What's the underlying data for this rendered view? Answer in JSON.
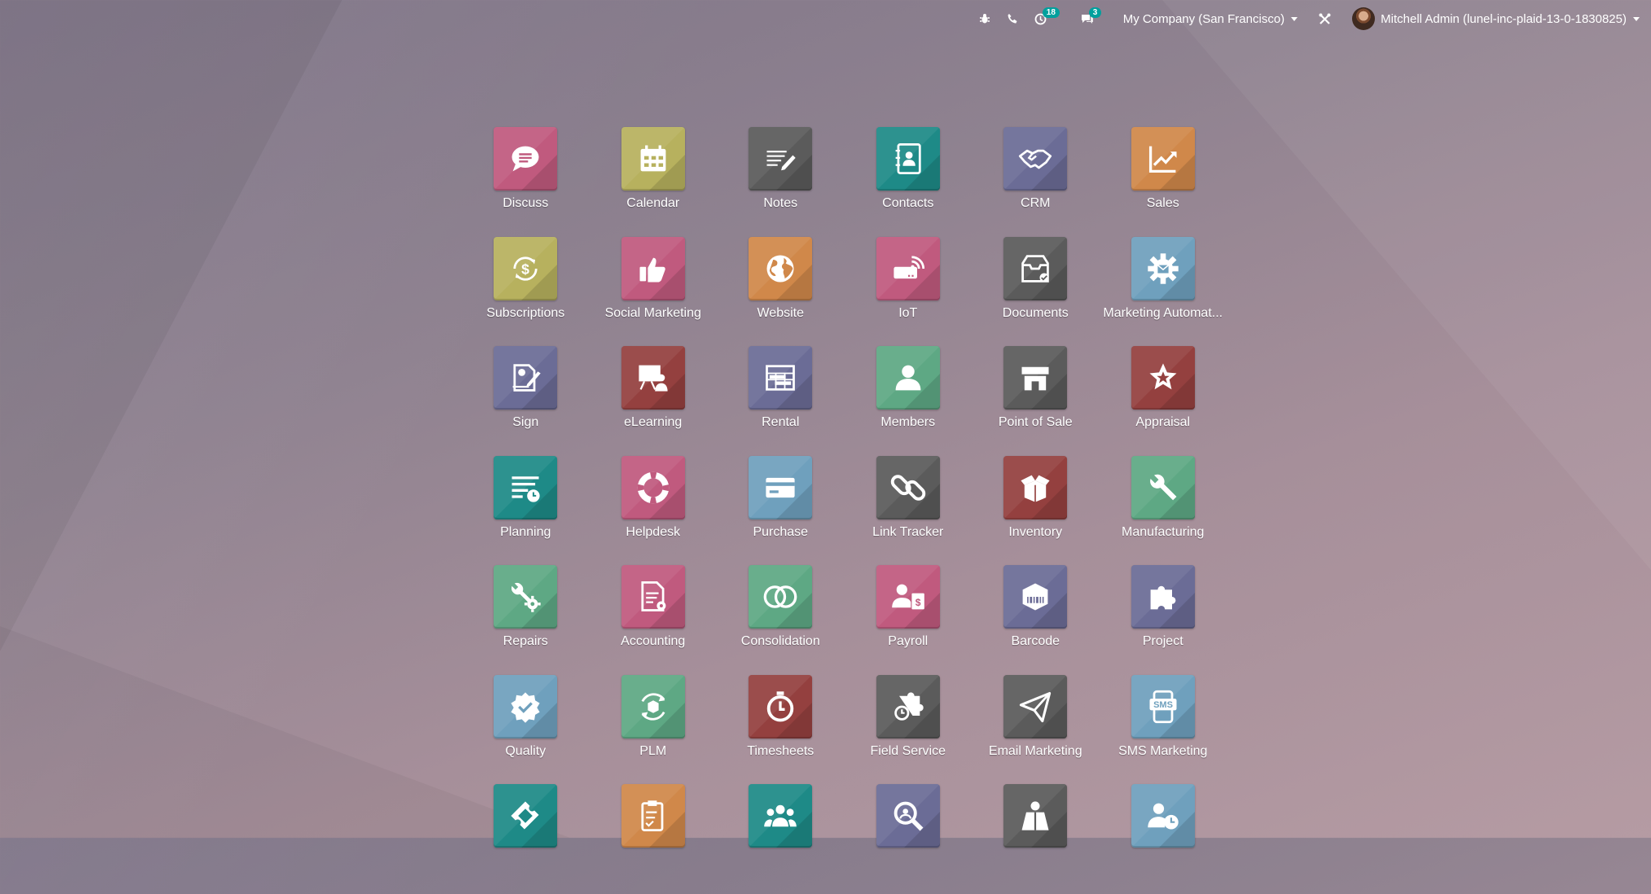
{
  "topbar": {
    "activities_count": "18",
    "messages_count": "3",
    "company": "My Company (San Francisco)",
    "user": "Mitchell Admin (lunel-inc-plaid-13-0-1830825)"
  },
  "apps": [
    {
      "name": "Discuss",
      "color": "#c05a7e",
      "icon": "chat-bubble-icon"
    },
    {
      "name": "Calendar",
      "color": "#b7b15e",
      "icon": "calendar-icon"
    },
    {
      "name": "Notes",
      "color": "#5b5b5b",
      "icon": "notes-pencil-icon"
    },
    {
      "name": "Contacts",
      "color": "#1e8a87",
      "icon": "address-book-icon"
    },
    {
      "name": "CRM",
      "color": "#6b6c96",
      "icon": "handshake-icon"
    },
    {
      "name": "Sales",
      "color": "#d0884a",
      "icon": "trending-chart-icon"
    },
    {
      "name": "Subscriptions",
      "color": "#b7b15e",
      "icon": "recurring-dollar-icon"
    },
    {
      "name": "Social Marketing",
      "color": "#c05a7e",
      "icon": "thumbs-up-icon"
    },
    {
      "name": "Website",
      "color": "#d0884a",
      "icon": "globe-icon"
    },
    {
      "name": "IoT",
      "color": "#c05a7e",
      "icon": "iot-device-icon"
    },
    {
      "name": "Documents",
      "color": "#5b5b5b",
      "icon": "document-tray-icon"
    },
    {
      "name": "Marketing Automat...",
      "color": "#6fa0bd",
      "icon": "gear-mail-icon"
    },
    {
      "name": "Sign",
      "color": "#6b6c96",
      "icon": "signature-icon"
    },
    {
      "name": "eLearning",
      "color": "#94403f",
      "icon": "teacher-board-icon"
    },
    {
      "name": "Rental",
      "color": "#6b6c96",
      "icon": "rental-schedule-icon"
    },
    {
      "name": "Members",
      "color": "#5ea884",
      "icon": "person-icon"
    },
    {
      "name": "Point of Sale",
      "color": "#5b5b5b",
      "icon": "shop-icon"
    },
    {
      "name": "Appraisal",
      "color": "#94403f",
      "icon": "star-badge-icon"
    },
    {
      "name": "Planning",
      "color": "#1e8a87",
      "icon": "planning-clock-icon"
    },
    {
      "name": "Helpdesk",
      "color": "#c05a7e",
      "icon": "lifebuoy-icon"
    },
    {
      "name": "Purchase",
      "color": "#6fa0bd",
      "icon": "credit-card-icon"
    },
    {
      "name": "Link Tracker",
      "color": "#5b5b5b",
      "icon": "link-chain-icon"
    },
    {
      "name": "Inventory",
      "color": "#94403f",
      "icon": "open-box-icon"
    },
    {
      "name": "Manufacturing",
      "color": "#5ea884",
      "icon": "wrench-icon"
    },
    {
      "name": "Repairs",
      "color": "#5ea884",
      "icon": "wrench-gear-icon"
    },
    {
      "name": "Accounting",
      "color": "#c05a7e",
      "icon": "invoice-gear-icon"
    },
    {
      "name": "Consolidation",
      "color": "#5ea884",
      "icon": "overlap-circles-icon"
    },
    {
      "name": "Payroll",
      "color": "#c05a7e",
      "icon": "payroll-person-icon"
    },
    {
      "name": "Barcode",
      "color": "#6b6c96",
      "icon": "barcode-box-icon"
    },
    {
      "name": "Project",
      "color": "#6b6c96",
      "icon": "puzzle-icon"
    },
    {
      "name": "Quality",
      "color": "#6fa0bd",
      "icon": "quality-seal-icon"
    },
    {
      "name": "PLM",
      "color": "#5ea884",
      "icon": "product-lifecycle-icon"
    },
    {
      "name": "Timesheets",
      "color": "#94403f",
      "icon": "stopwatch-icon"
    },
    {
      "name": "Field Service",
      "color": "#5b5b5b",
      "icon": "field-service-icon"
    },
    {
      "name": "Email Marketing",
      "color": "#5b5b5b",
      "icon": "paper-plane-icon"
    },
    {
      "name": "SMS Marketing",
      "color": "#6fa0bd",
      "icon": "sms-phone-icon"
    },
    {
      "name": "",
      "color": "#1e8a87",
      "icon": "ticket-icon"
    },
    {
      "name": "",
      "color": "#d0884a",
      "icon": "survey-clipboard-icon"
    },
    {
      "name": "",
      "color": "#1e8a87",
      "icon": "team-icon"
    },
    {
      "name": "",
      "color": "#6b6c96",
      "icon": "magnifier-icon"
    },
    {
      "name": "",
      "color": "#5b5b5b",
      "icon": "superhero-icon"
    },
    {
      "name": "",
      "color": "#6fa0bd",
      "icon": "person-clock-icon"
    }
  ]
}
